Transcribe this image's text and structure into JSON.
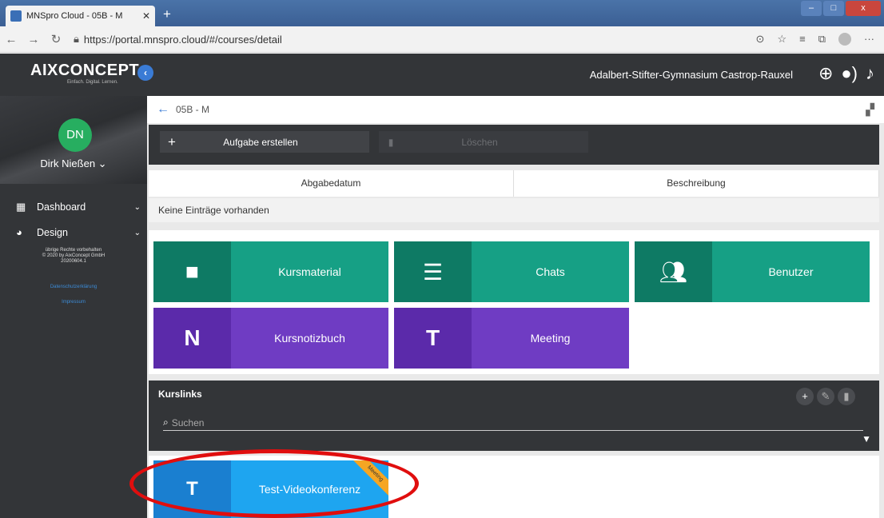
{
  "browser": {
    "tab_title": "MNSpro Cloud - 05B - M",
    "tab_close": "✕",
    "new_tab": "+",
    "url": "https://portal.mnspro.cloud/#/courses/detail"
  },
  "header": {
    "logo": "AIXCONCEPT",
    "logo_sub": "Einfach. Digital. Lernen.",
    "school": "Adalbert-Stifter-Gymnasium Castrop-Rauxel"
  },
  "sidebar": {
    "avatar_initials": "DN",
    "user_name": "Dirk Nießen ⌄",
    "menu": [
      {
        "label": "Dashboard",
        "icon": "dashboard-icon"
      },
      {
        "label": "Design",
        "icon": "palette-icon"
      }
    ],
    "copyright_lines": [
      "übrige Rechte vorbehalten",
      "© 2020 by AixConcept GmbH",
      "20200604.1"
    ],
    "privacy_link": "Datenschutzerklärung",
    "imprint_link": "Impressum"
  },
  "main": {
    "breadcrumb": "05B - M",
    "create_task_label": "Aufgabe erstellen",
    "delete_label": "Löschen",
    "columns": [
      "Abgabedatum",
      "Beschreibung"
    ],
    "empty_message": "Keine Einträge vorhanden",
    "tiles": [
      {
        "label": "Kursmaterial",
        "icon": "folder-icon",
        "color": "#16a085"
      },
      {
        "label": "Chats",
        "icon": "chat-icon",
        "color": "#16a085"
      },
      {
        "label": "Benutzer",
        "icon": "users-icon",
        "color": "#16a085"
      },
      {
        "label": "Kursnotizbuch",
        "icon": "onenote-icon",
        "color": "#6f3cc3"
      },
      {
        "label": "Meeting",
        "icon": "teams-icon",
        "color": "#6f3cc3"
      }
    ],
    "links": {
      "title": "Kurslinks",
      "search_placeholder": "Suchen"
    },
    "meeting_tile": {
      "label": "Test-Videokonferenz",
      "ribbon": "Meeting",
      "color": "#1ea5f0"
    }
  },
  "colors": {
    "annotation_ellipse": "#e00e0e"
  }
}
